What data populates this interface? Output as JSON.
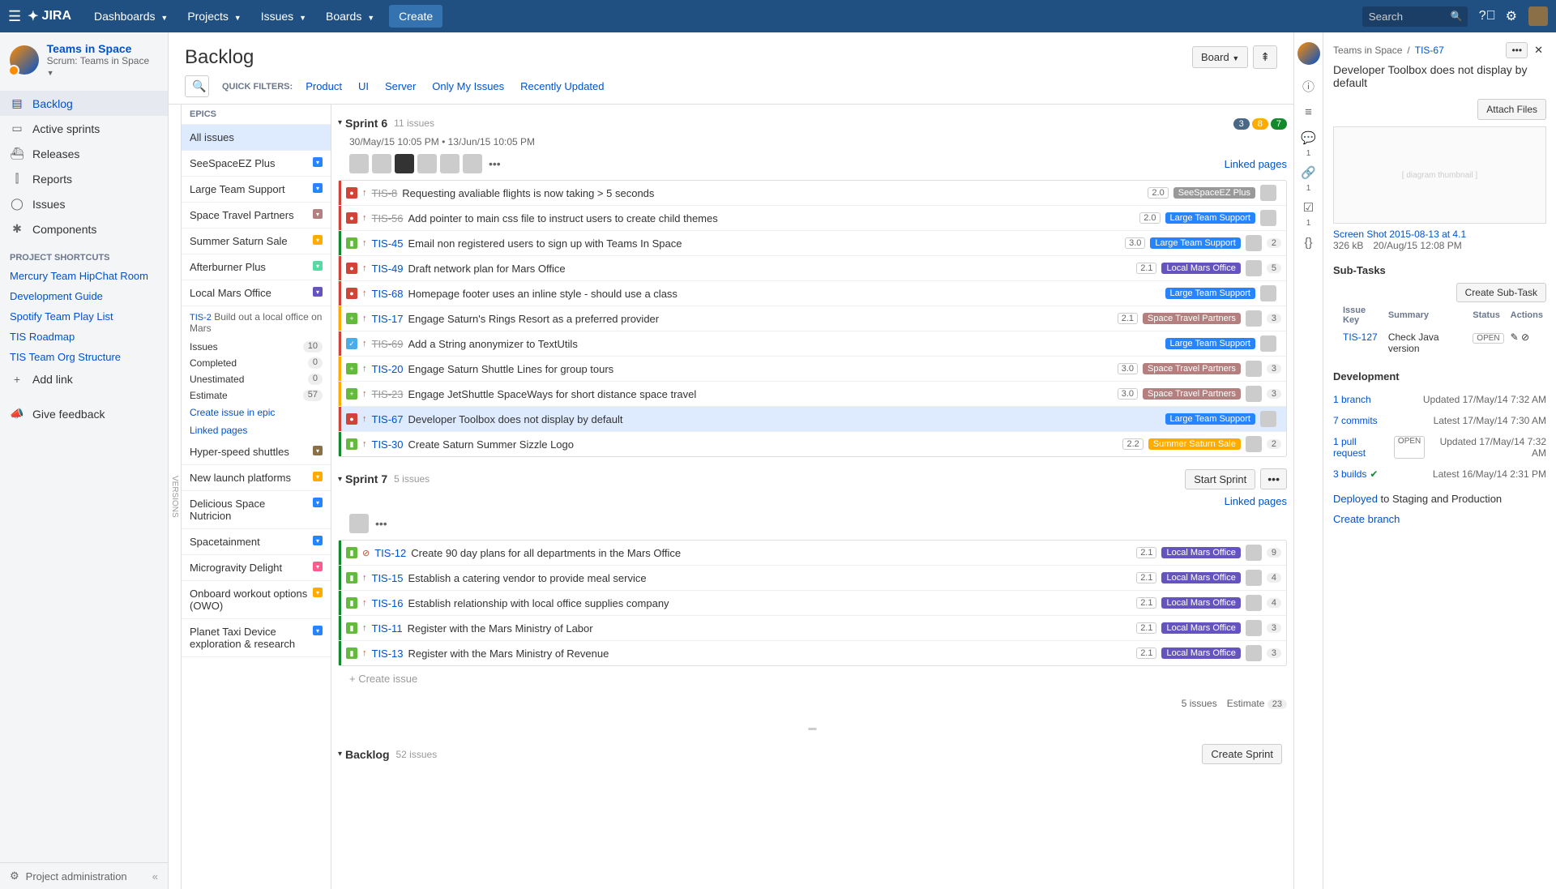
{
  "topbar": {
    "logo": "JIRA",
    "nav": [
      "Dashboards",
      "Projects",
      "Issues",
      "Boards"
    ],
    "create": "Create",
    "searchPlaceholder": "Search"
  },
  "project": {
    "name": "Teams in Space",
    "sub": "Scrum: Teams in Space"
  },
  "sidebarNav": [
    {
      "icon": "▤",
      "label": "Backlog",
      "active": true
    },
    {
      "icon": "▭",
      "label": "Active sprints"
    },
    {
      "icon": "⛴",
      "label": "Releases"
    },
    {
      "icon": "⫿",
      "label": "Reports"
    },
    {
      "icon": "◯",
      "label": "Issues"
    },
    {
      "icon": "✱",
      "label": "Components"
    }
  ],
  "shortcutsHeader": "PROJECT SHORTCUTS",
  "shortcuts": [
    "Mercury Team HipChat Room",
    "Development Guide",
    "Spotify Team Play List",
    "TIS Roadmap",
    "TIS Team Org Structure"
  ],
  "addLink": "Add link",
  "feedback": "Give feedback",
  "projectAdmin": "Project administration",
  "pageTitle": "Backlog",
  "boardBtn": "Board",
  "quickFiltersLabel": "QUICK FILTERS:",
  "quickFilters": [
    "Product",
    "UI",
    "Server",
    "Only My Issues",
    "Recently Updated"
  ],
  "versionsLabel": "VERSIONS",
  "epicsHeader": "EPICS",
  "allIssues": "All issues",
  "epics": [
    {
      "name": "SeeSpaceEZ Plus",
      "color": "#2684ff"
    },
    {
      "name": "Large Team Support",
      "color": "#2684ff"
    },
    {
      "name": "Space Travel Partners",
      "color": "#b37f7f"
    },
    {
      "name": "Summer Saturn Sale",
      "color": "#ffab00"
    },
    {
      "name": "Afterburner Plus",
      "color": "#57d9a3"
    }
  ],
  "epicDetail": {
    "name": "Local Mars Office",
    "color": "#6554c0",
    "key": "TIS-2",
    "desc": "Build out a local office on Mars",
    "stats": [
      {
        "l": "Issues",
        "v": "10"
      },
      {
        "l": "Completed",
        "v": "0"
      },
      {
        "l": "Unestimated",
        "v": "0"
      },
      {
        "l": "Estimate",
        "v": "57"
      }
    ],
    "links": [
      "Create issue in epic",
      "Linked pages"
    ]
  },
  "epicsMore": [
    {
      "name": "Hyper-speed shuttles",
      "color": "#8b6f47"
    },
    {
      "name": "New launch platforms",
      "color": "#ffab00"
    },
    {
      "name": "Delicious Space Nutricion",
      "color": "#2684ff"
    },
    {
      "name": "Spacetainment",
      "color": "#2684ff"
    },
    {
      "name": "Microgravity Delight",
      "color": "#ff5c8d"
    },
    {
      "name": "Onboard workout options (OWO)",
      "color": "#ffab00"
    },
    {
      "name": "Planet Taxi Device exploration & research",
      "color": "#2684ff"
    }
  ],
  "sprint6": {
    "name": "Sprint 6",
    "count": "11 issues",
    "pills": [
      {
        "v": "3",
        "c": "#4a6785"
      },
      {
        "v": "8",
        "c": "#ffab00"
      },
      {
        "v": "7",
        "c": "#14892c"
      }
    ],
    "dateStart": "30/May/15 10:05 PM",
    "dateEnd": "13/Jun/15 10:05 PM",
    "linkedPages": "Linked pages",
    "issues": [
      {
        "bar": "#d04437",
        "type": "bug",
        "pri": "↑",
        "pc": "#d04437",
        "key": "TIS-8",
        "done": true,
        "sum": "Requesting avaliable flights is now taking > 5 seconds",
        "ver": "2.0",
        "epic": "SeeSpaceEZ Plus",
        "ec": "#999",
        "est": ""
      },
      {
        "bar": "#d04437",
        "type": "bug",
        "pri": "↑",
        "pc": "#d04437",
        "key": "TIS-56",
        "done": true,
        "sum": "Add pointer to main css file to instruct users to create child themes",
        "ver": "2.0",
        "epic": "Large Team Support",
        "ec": "#2684ff",
        "est": ""
      },
      {
        "bar": "#14892c",
        "type": "story",
        "pri": "↑",
        "pc": "#d04437",
        "key": "TIS-45",
        "done": false,
        "sum": "Email non registered users to sign up with Teams In Space",
        "ver": "3.0",
        "epic": "Large Team Support",
        "ec": "#2684ff",
        "est": "2"
      },
      {
        "bar": "#d04437",
        "type": "bug",
        "pri": "↑",
        "pc": "#d04437",
        "key": "TIS-49",
        "done": false,
        "sum": "Draft network plan for Mars Office",
        "ver": "2.1",
        "epic": "Local Mars Office",
        "ec": "#6554c0",
        "est": "5"
      },
      {
        "bar": "#d04437",
        "type": "bug",
        "pri": "↑",
        "pc": "#d04437",
        "key": "TIS-68",
        "done": false,
        "sum": "Homepage footer uses an inline style - should use a class",
        "ver": "",
        "epic": "Large Team Support",
        "ec": "#2684ff",
        "est": ""
      },
      {
        "bar": "#ffab00",
        "type": "new",
        "pri": "↑",
        "pc": "#d04437",
        "key": "TIS-17",
        "done": false,
        "sum": "Engage Saturn's Rings Resort as a preferred provider",
        "ver": "2.1",
        "epic": "Space Travel Partners",
        "ec": "#b37f7f",
        "est": "3"
      },
      {
        "bar": "#d04437",
        "type": "task",
        "pri": "↑",
        "pc": "#d04437",
        "key": "TIS-69",
        "done": true,
        "sum": "Add a String anonymizer to TextUtils",
        "ver": "",
        "epic": "Large Team Support",
        "ec": "#2684ff",
        "est": ""
      },
      {
        "bar": "#ffab00",
        "type": "new",
        "pri": "↑",
        "pc": "#d04437",
        "key": "TIS-20",
        "done": false,
        "sum": "Engage Saturn Shuttle Lines for group tours",
        "ver": "3.0",
        "epic": "Space Travel Partners",
        "ec": "#b37f7f",
        "est": "3"
      },
      {
        "bar": "#ffab00",
        "type": "new",
        "pri": "↑",
        "pc": "#d04437",
        "key": "TIS-23",
        "done": true,
        "sum": "Engage JetShuttle SpaceWays for short distance space travel",
        "ver": "3.0",
        "epic": "Space Travel Partners",
        "ec": "#b37f7f",
        "est": "3"
      },
      {
        "bar": "#d04437",
        "type": "bug",
        "pri": "↑",
        "pc": "#d04437",
        "key": "TIS-67",
        "done": false,
        "sum": "Developer Toolbox does not display by default",
        "ver": "",
        "epic": "Large Team Support",
        "ec": "#2684ff",
        "est": "",
        "sel": true
      },
      {
        "bar": "#14892c",
        "type": "story",
        "pri": "↑",
        "pc": "#d04437",
        "key": "TIS-30",
        "done": false,
        "sum": "Create Saturn Summer Sizzle Logo",
        "ver": "2.2",
        "epic": "Summer Saturn Sale",
        "ec": "#ffab00",
        "est": "2"
      }
    ]
  },
  "sprint7": {
    "name": "Sprint 7",
    "count": "5 issues",
    "startBtn": "Start Sprint",
    "linkedPages": "Linked pages",
    "issues": [
      {
        "bar": "#14892c",
        "type": "story",
        "pri": "⊘",
        "pc": "#d04437",
        "key": "TIS-12",
        "done": false,
        "sum": "Create 90 day plans for all departments in the Mars Office",
        "ver": "2.1",
        "epic": "Local Mars Office",
        "ec": "#6554c0",
        "est": "9"
      },
      {
        "bar": "#14892c",
        "type": "story",
        "pri": "↑",
        "pc": "#d04437",
        "key": "TIS-15",
        "done": false,
        "sum": "Establish a catering vendor to provide meal service",
        "ver": "2.1",
        "epic": "Local Mars Office",
        "ec": "#6554c0",
        "est": "4"
      },
      {
        "bar": "#14892c",
        "type": "story",
        "pri": "↑",
        "pc": "#d04437",
        "key": "TIS-16",
        "done": false,
        "sum": "Establish relationship with local office supplies company",
        "ver": "2.1",
        "epic": "Local Mars Office",
        "ec": "#6554c0",
        "est": "4"
      },
      {
        "bar": "#14892c",
        "type": "story",
        "pri": "↑",
        "pc": "#d04437",
        "key": "TIS-11",
        "done": false,
        "sum": "Register with the Mars Ministry of Labor",
        "ver": "2.1",
        "epic": "Local Mars Office",
        "ec": "#6554c0",
        "est": "3"
      },
      {
        "bar": "#14892c",
        "type": "story",
        "pri": "↑",
        "pc": "#d04437",
        "key": "TIS-13",
        "done": false,
        "sum": "Register with the Mars Ministry of Revenue",
        "ver": "2.1",
        "epic": "Local Mars Office",
        "ec": "#6554c0",
        "est": "3"
      }
    ],
    "createIssue": "+  Create issue",
    "footerCount": "5 issues",
    "footerEst": "Estimate",
    "footerEstVal": "23"
  },
  "backlog": {
    "name": "Backlog",
    "count": "52 issues",
    "createBtn": "Create Sprint"
  },
  "detail": {
    "crumb": "Teams in Space",
    "key": "TIS-67",
    "title": "Developer Toolbox does not display by default",
    "attachBtn": "Attach Files",
    "attachName": "Screen Shot 2015-08-13 at 4.1",
    "attachSize": "326 kB",
    "attachDate": "20/Aug/15 12:08 PM",
    "subTasksH": "Sub-Tasks",
    "createSubBtn": "Create Sub-Task",
    "stHeaders": [
      "Issue Key",
      "Summary",
      "Status",
      "Actions"
    ],
    "stKey": "TIS-127",
    "stSum": "Check Java version",
    "stStatus": "OPEN",
    "devH": "Development",
    "dev": [
      {
        "l": "1 branch",
        "m": "Updated 17/May/14 7:32 AM"
      },
      {
        "l": "7 commits",
        "m": "Latest 17/May/14 7:30 AM"
      },
      {
        "l": "1 pull request",
        "s": "OPEN",
        "m": "Updated 17/May/14 7:32 AM"
      },
      {
        "l": "3 builds",
        "check": true,
        "m": "Latest 16/May/14 2:31 PM"
      }
    ],
    "deployed": "Deployed",
    "deployedTo": " to Staging and Production",
    "createBranch": "Create branch"
  }
}
